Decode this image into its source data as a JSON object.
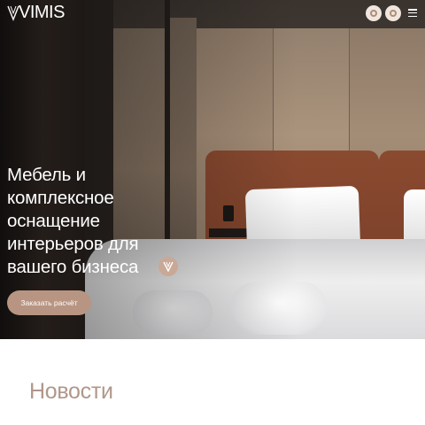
{
  "header": {
    "logo_text": "VIMIS",
    "logo_icon": "vimis-v-logo",
    "action_icons": [
      "circle-icon",
      "circle-icon"
    ],
    "menu_icon": "hamburger-icon"
  },
  "hero": {
    "headline_lines": [
      "Мебель и",
      "комплексное",
      "оснащение",
      "интерьеров для",
      "вашего бизнеса"
    ],
    "badge_icon": "v-logo-icon",
    "cta_label": "Заказать расчёт"
  },
  "news": {
    "title": "Новости"
  },
  "colors": {
    "accent": "#b89582",
    "news_title": "#b0978a",
    "badge": "#c9a896"
  }
}
